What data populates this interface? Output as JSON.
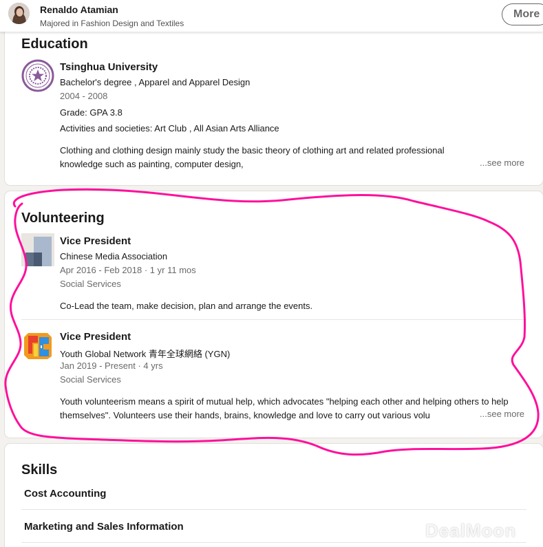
{
  "header": {
    "name": "Renaldo Atamian",
    "headline": "Majored in Fashion Design and Textiles",
    "more_label": "More"
  },
  "education": {
    "title": "Education",
    "school": "Tsinghua University",
    "degree": "Bachelor's degree , Apparel and Apparel Design",
    "dates": "2004 - 2008",
    "grade": "Grade: GPA 3.8",
    "activities": "Activities and societies: Art Club , All Asian Arts Alliance",
    "description": "Clothing and clothing design mainly study the basic theory of clothing art and related professional knowledge such as painting, computer design,",
    "see_more": "...see more"
  },
  "volunteering": {
    "title": "Volunteering",
    "items": [
      {
        "role": "Vice President",
        "org": "Chinese Media Association",
        "dates": "Apr 2016 - Feb 2018 · 1 yr 11 mos",
        "cause": "Social Services",
        "description": "Co-Lead the team, make decision, plan and arrange the events."
      },
      {
        "role": "Vice President",
        "org": "Youth Global Network 青年全球網絡 (YGN)",
        "dates": "Jan 2019 - Present · 4 yrs",
        "cause": "Social Services",
        "description": "Youth volunteerism means a spirit of mutual help, which advocates \"helping each other and helping others to help themselves\". Volunteers use their hands, brains, knowledge and love to carry out various volu",
        "see_more": "...see more"
      }
    ]
  },
  "skills": {
    "title": "Skills",
    "items": [
      "Cost Accounting",
      "Marketing and Sales Information"
    ]
  },
  "watermark": "DealMoon",
  "colors": {
    "annotation": "#ff0f9b",
    "text_primary": "#000000e6",
    "text_secondary": "#00000099"
  },
  "icons": {
    "education_logo": "tsinghua-seal",
    "volunteer_logo_1": "chinese-media-association-logo",
    "volunteer_logo_2": "ygn-logo"
  }
}
